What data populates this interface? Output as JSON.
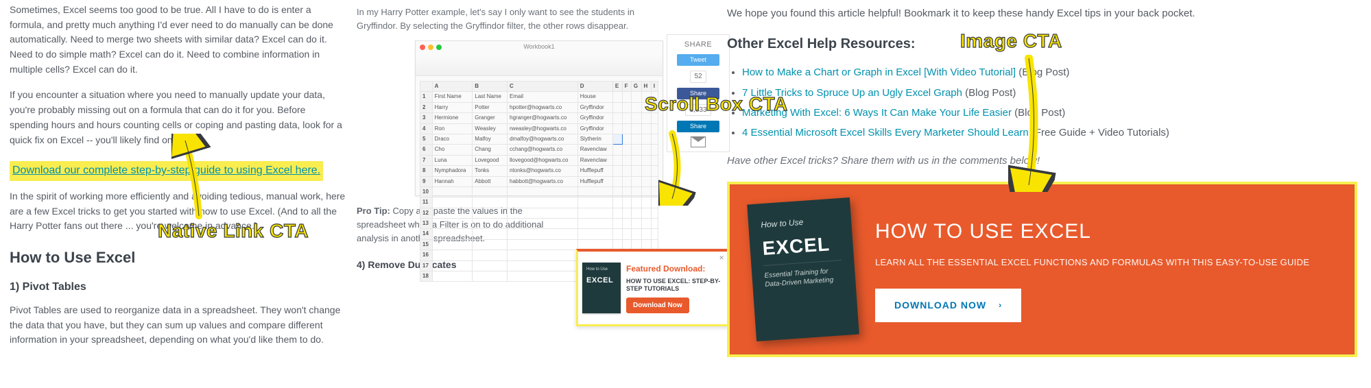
{
  "left": {
    "p1": "Sometimes, Excel seems too good to be true. All I have to do is enter a formula, and pretty much anything I'd ever need to do manually can be done automatically. Need to merge two sheets with similar data? Excel can do it. Need to do simple math? Excel can do it. Need to combine information in multiple cells? Excel can do it.",
    "p2": "If you encounter a situation where you need to manually update your data, you're probably missing out on a formula that can do it for you. Before spending hours and hours counting cells or coping and pasting data, look for a quick fix on Excel -- you'll likely find one.",
    "cta_link": "Download our complete step-by-step guide to using Excel here.",
    "p3": "In the spirit of working more efficiently and avoiding tedious, manual work, here are a few Excel tricks to get you started with how to use Excel. (And to all the Harry Potter fans out there ... you're welcome in advance.)",
    "h2": "How to Use Excel",
    "h3": "1) Pivot Tables",
    "p4": "Pivot Tables are used to reorganize data in a spreadsheet. They won't change the data that you have, but they can sum up values and compare different information in your spreadsheet, depending on what you'd like them to do."
  },
  "middle": {
    "intro": "In my Harry Potter example, let's say I only want to see the students in Gryffindor. By selecting the Gryffindor filter, the other rows disappear.",
    "workbook_title": "Workbook1",
    "columns": [
      "",
      "A",
      "B",
      "C",
      "D",
      "E",
      "F",
      "G",
      "H",
      "I"
    ],
    "headers": [
      "",
      "First Name",
      "Last Name",
      "Email",
      "House",
      "",
      "",
      "",
      "",
      ""
    ],
    "rows": [
      [
        "1",
        "First Name",
        "Last Name",
        "Email",
        "House",
        "",
        "",
        "",
        "",
        ""
      ],
      [
        "2",
        "Harry",
        "Potter",
        "hpotter@hogwarts.co",
        "Gryffindor",
        "",
        "",
        "",
        "",
        ""
      ],
      [
        "3",
        "Hermione",
        "Granger",
        "hgranger@hogwarts.co",
        "Gryffindor",
        "",
        "",
        "",
        "",
        ""
      ],
      [
        "4",
        "Ron",
        "Weasley",
        "rweasley@hogwarts.co",
        "Gryffindor",
        "",
        "",
        "",
        "",
        ""
      ],
      [
        "5",
        "Draco",
        "Malfoy",
        "dmalfoy@hogwarts.co",
        "Slytherin",
        "",
        "",
        "",
        "",
        ""
      ],
      [
        "6",
        "Cho",
        "Chang",
        "cchang@hogwarts.co",
        "Ravenclaw",
        "",
        "",
        "",
        "",
        ""
      ],
      [
        "7",
        "Luna",
        "Lovegood",
        "llovegood@hogwarts.co",
        "Ravenclaw",
        "",
        "",
        "",
        "",
        ""
      ],
      [
        "8",
        "Nymphadora",
        "Tonks",
        "ntonks@hogwarts.co",
        "Hufflepuff",
        "",
        "",
        "",
        "",
        ""
      ],
      [
        "9",
        "Hannah",
        "Abbott",
        "habbott@hogwarts.co",
        "Hufflepuff",
        "",
        "",
        "",
        "",
        ""
      ],
      [
        "10",
        "",
        "",
        "",
        "",
        "",
        "",
        "",
        "",
        ""
      ],
      [
        "11",
        "",
        "",
        "",
        "",
        "",
        "",
        "",
        "",
        ""
      ],
      [
        "12",
        "",
        "",
        "",
        "",
        "",
        "",
        "",
        "",
        ""
      ],
      [
        "13",
        "",
        "",
        "",
        "",
        "",
        "",
        "",
        "",
        ""
      ],
      [
        "14",
        "",
        "",
        "",
        "",
        "",
        "",
        "",
        "",
        ""
      ],
      [
        "15",
        "",
        "",
        "",
        "",
        "",
        "",
        "",
        "",
        ""
      ],
      [
        "16",
        "",
        "",
        "",
        "",
        "",
        "",
        "",
        "",
        ""
      ],
      [
        "17",
        "",
        "",
        "",
        "",
        "",
        "",
        "",
        "",
        ""
      ],
      [
        "18",
        "",
        "",
        "",
        "",
        "",
        "",
        "",
        "",
        ""
      ]
    ],
    "share": {
      "title": "SHARE",
      "tweet": "Tweet",
      "tweet_count": "52",
      "fb": "Share",
      "fb_count": "1,833",
      "li": "Share"
    },
    "protip_label": "Pro Tip:",
    "protip_text": " Copy and paste the values in the spreadsheet when a Filter is on to do additional analysis in another spreadsheet.",
    "h4": "4) Remove Duplicates",
    "scrollbox": {
      "feat": "Featured Download:",
      "title": "HOW TO USE EXCEL: STEP-BY-STEP TUTORIALS",
      "btn": "Download Now",
      "book_top": "How to Use",
      "book_big": "EXCEL"
    }
  },
  "right": {
    "p1": "We hope you found this article helpful! Bookmark it to keep these handy Excel tips in your back pocket.",
    "h2": "Other Excel Help Resources:",
    "items": [
      {
        "link": "How to Make a Chart or Graph in Excel [With Video Tutorial]",
        "suffix": " (Blog Post)"
      },
      {
        "link": "7 Little Tricks to Spruce Up an Ugly Excel Graph",
        "suffix": " (Blog Post)"
      },
      {
        "link": "Marketing With Excel: 6 Ways It Can Make Your Life Easier",
        "suffix": " (Blog Post)"
      },
      {
        "link": "4 Essential Microsoft Excel Skills Every Marketer Should Learn",
        "suffix": " (Free Guide + Video Tutorials)"
      }
    ],
    "em": "Have other Excel tricks? Share them with us in the comments below!",
    "cta": {
      "book_top": "How to Use",
      "book_big": "EXCEL",
      "book_sub": "Essential Training for Data-Driven Marketing",
      "title": "HOW TO USE EXCEL",
      "sub": "LEARN ALL THE ESSENTIAL EXCEL FUNCTIONS AND FORMULAS WITH THIS EASY-TO-USE GUIDE",
      "btn": "DOWNLOAD NOW"
    }
  },
  "annotations": {
    "native": "Native Link CTA",
    "scroll": "Scroll Box CTA",
    "image": "Image CTA"
  }
}
